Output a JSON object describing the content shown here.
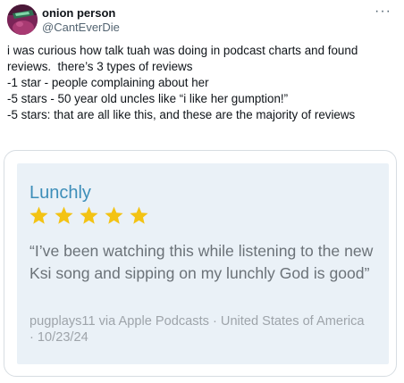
{
  "user": {
    "display_name": "onion person",
    "handle": "@CantEverDie"
  },
  "post": {
    "lines": [
      "i was curious how talk tuah was doing in podcast charts and found reviews.  there’s 3 types of reviews",
      "",
      "-1 star - people complaining about her",
      "-5 stars - 50 year old uncles like “i like her gumption!”",
      "-5 stars: that are all like this, and these are the majority of reviews"
    ]
  },
  "review": {
    "title": "Lunchly",
    "rating": 5,
    "rating_max": 5,
    "body": "“I’ve been watching this while listening to the new Ksi song and sipping on my lunchly God is good”",
    "meta": "pugplays11 via Apple Podcasts · United States of America · 10/23/24"
  },
  "colors": {
    "star": "#f3c314",
    "review_title": "#3d8eb9",
    "review_bg": "#eaf1f7"
  }
}
